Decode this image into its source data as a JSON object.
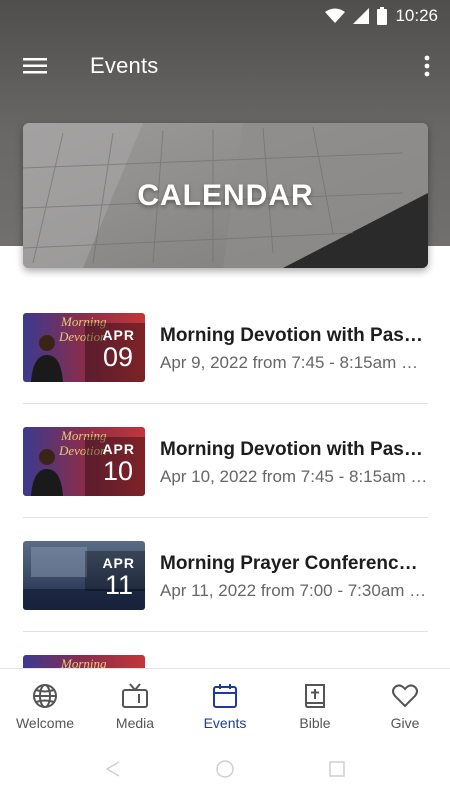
{
  "status_bar": {
    "time": "10:26"
  },
  "app_bar": {
    "title": "Events"
  },
  "hero": {
    "title": "CALENDAR"
  },
  "events": [
    {
      "month": "APR",
      "day": "09",
      "title": "Morning Devotion with Past…",
      "subtitle": "Apr 9, 2022 from 7:45 - 8:15am …",
      "thumb_style": "devotion"
    },
    {
      "month": "APR",
      "day": "10",
      "title": "Morning Devotion with Past…",
      "subtitle": "Apr 10, 2022 from 7:45 - 8:15am …",
      "thumb_style": "devotion"
    },
    {
      "month": "APR",
      "day": "11",
      "title": "Morning Prayer Conference …",
      "subtitle": "Apr 11, 2022 from 7:00 - 7:30am …",
      "thumb_style": "prayer"
    }
  ],
  "bottom_nav": [
    {
      "label": "Welcome",
      "icon": "globe-icon",
      "active": false
    },
    {
      "label": "Media",
      "icon": "tv-icon",
      "active": false
    },
    {
      "label": "Events",
      "icon": "calendar-icon",
      "active": true
    },
    {
      "label": "Bible",
      "icon": "bible-icon",
      "active": false
    },
    {
      "label": "Give",
      "icon": "heart-icon",
      "active": false
    }
  ],
  "colors": {
    "accent": "#1f3a9e",
    "header": "#5a5958"
  }
}
